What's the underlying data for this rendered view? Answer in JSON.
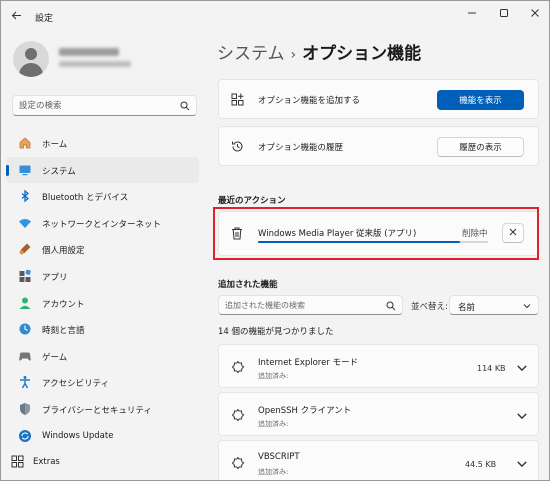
{
  "window": {
    "title": "設定"
  },
  "sidebar": {
    "search_placeholder": "設定の検索",
    "items": [
      {
        "label": "ホーム",
        "icon": "home-icon"
      },
      {
        "label": "システム",
        "icon": "system-icon",
        "active": true
      },
      {
        "label": "Bluetooth とデバイス",
        "icon": "bluetooth-icon"
      },
      {
        "label": "ネットワークとインターネット",
        "icon": "network-icon"
      },
      {
        "label": "個人用設定",
        "icon": "personalization-icon"
      },
      {
        "label": "アプリ",
        "icon": "apps-icon"
      },
      {
        "label": "アカウント",
        "icon": "account-icon"
      },
      {
        "label": "時刻と言語",
        "icon": "time-language-icon"
      },
      {
        "label": "ゲーム",
        "icon": "gaming-icon"
      },
      {
        "label": "アクセシビリティ",
        "icon": "accessibility-icon"
      },
      {
        "label": "プライバシーとセキュリティ",
        "icon": "privacy-icon"
      },
      {
        "label": "Windows Update",
        "icon": "windows-update-icon"
      }
    ],
    "extras_label": "Extras"
  },
  "breadcrumb": {
    "parent": "システム",
    "separator": "›",
    "current": "オプション機能"
  },
  "add_feature": {
    "label": "オプション機能を追加する",
    "button": "機能を表示"
  },
  "history": {
    "label": "オプション機能の履歴",
    "button": "履歴の表示"
  },
  "recent": {
    "section_title": "最近のアクション",
    "item": {
      "name": "Windows Media Player 従来版 (アプリ)",
      "status": "削除中",
      "progress": 0.88
    }
  },
  "added": {
    "section_title": "追加された機能",
    "search_placeholder": "追加された機能の検索",
    "sort_label": "並べ替え:",
    "sort_value": "名前",
    "count_text": "14 個の機能が見つかりました",
    "items": [
      {
        "name": "Internet Explorer モード",
        "status": "追加済み:",
        "size": "114 KB"
      },
      {
        "name": "OpenSSH クライアント",
        "status": "追加済み:",
        "size": ""
      },
      {
        "name": "VBSCRIPT",
        "status": "追加済み:",
        "size": "44.5 KB"
      }
    ]
  },
  "colors": {
    "accent": "#005fb8",
    "highlight": "#e0202c",
    "background": "#f3f3f3"
  }
}
